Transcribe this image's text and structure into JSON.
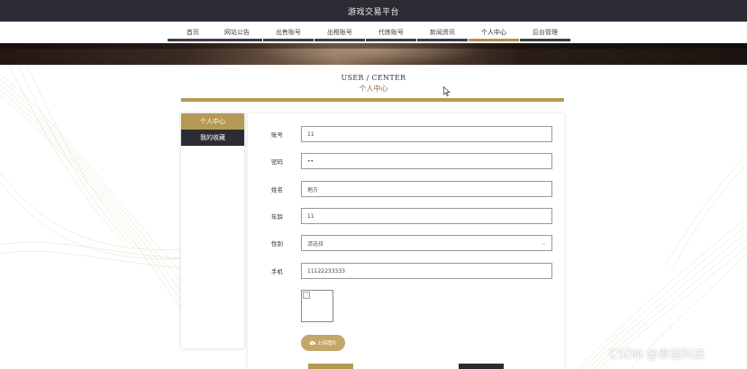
{
  "app": {
    "title": "游戏交易平台"
  },
  "nav": {
    "items": [
      {
        "label": "首页"
      },
      {
        "label": "网站公告"
      },
      {
        "label": "出售账号"
      },
      {
        "label": "出租账号"
      },
      {
        "label": "代练账号"
      },
      {
        "label": "新闻资讯"
      },
      {
        "label": "个人中心"
      },
      {
        "label": "后台管理"
      }
    ],
    "active": "个人中心"
  },
  "page": {
    "title_en": "USER / CENTER",
    "title_zh": "个人中心"
  },
  "sidebar": {
    "items": [
      {
        "label": "个人中心"
      },
      {
        "label": "我的收藏"
      }
    ]
  },
  "form": {
    "account": {
      "label": "账号",
      "value": "11"
    },
    "password": {
      "label": "密码",
      "value": "••"
    },
    "name": {
      "label": "姓名",
      "value": "地方"
    },
    "age": {
      "label": "年龄",
      "value": "11"
    },
    "gender": {
      "label": "性别",
      "value": "请选择"
    },
    "phone": {
      "label": "手机",
      "value": "11122233333"
    },
    "upload_label": "上传图片"
  },
  "watermark": "CSDN @幸运科技",
  "colors": {
    "gold": "#b59a55",
    "dark": "#2c2c34",
    "topbar": "#2b2b33"
  }
}
